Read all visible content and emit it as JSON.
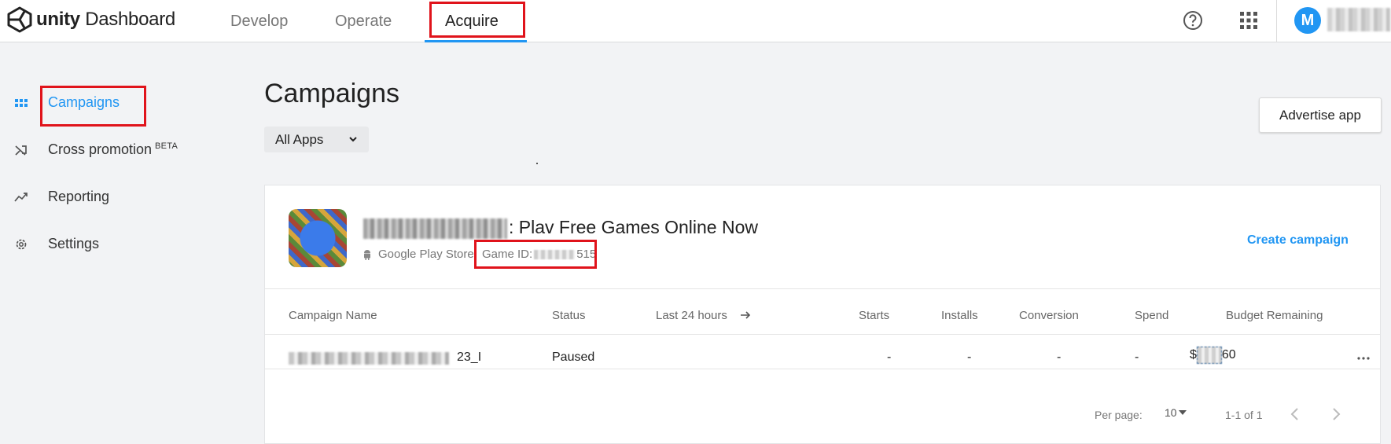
{
  "header": {
    "logo_brand": "unity",
    "logo_product": "Dashboard",
    "tabs": [
      {
        "label": "Develop"
      },
      {
        "label": "Operate"
      },
      {
        "label": "Acquire"
      }
    ],
    "avatar_initial": "M"
  },
  "sidebar": {
    "items": [
      {
        "label": "Campaigns",
        "icon": "grid-icon"
      },
      {
        "label": "Cross promotion",
        "badge": "BETA",
        "icon": "shuffle-icon"
      },
      {
        "label": "Reporting",
        "icon": "trending-up-icon"
      },
      {
        "label": "Settings",
        "icon": "gear-icon"
      }
    ]
  },
  "main": {
    "title": "Campaigns",
    "apps_filter": "All Apps",
    "advertise_button": "Advertise app"
  },
  "game": {
    "title_visible": ": Plav Free Games Online Now",
    "store": "Google Play Store",
    "game_id_label": "Game ID:",
    "game_id_visible_suffix": "515",
    "create_campaign": "Create campaign"
  },
  "table": {
    "columns": [
      "Campaign Name",
      "Status",
      "Last 24 hours",
      "Starts",
      "Installs",
      "Conversion",
      "Spend",
      "Budget Remaining"
    ],
    "rows": [
      {
        "name_visible_suffix": "23_I",
        "status": "Paused",
        "starts": "-",
        "installs": "-",
        "conversion": "-",
        "spend": "-",
        "budget_prefix": "$",
        "budget_suffix": "60"
      }
    ]
  },
  "pagination": {
    "per_page_label": "Per page:",
    "per_page_value": "10",
    "range": "1-1 of 1"
  },
  "colors": {
    "accent": "#2196f3",
    "highlight_box": "#e0131b"
  }
}
